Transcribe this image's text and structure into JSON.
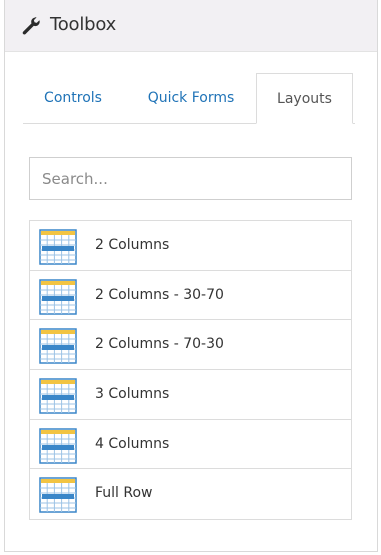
{
  "header": {
    "title": "Toolbox",
    "icon": "wrench-icon"
  },
  "tabs": [
    {
      "label": "Controls",
      "active": false
    },
    {
      "label": "Quick Forms",
      "active": false
    },
    {
      "label": "Layouts",
      "active": true
    }
  ],
  "search": {
    "placeholder": "Search...",
    "value": ""
  },
  "layouts": [
    {
      "label": "2 Columns"
    },
    {
      "label": "2 Columns - 30-70"
    },
    {
      "label": "2 Columns - 70-30"
    },
    {
      "label": "3 Columns"
    },
    {
      "label": "4 Columns"
    },
    {
      "label": "Full Row"
    }
  ],
  "colors": {
    "link": "#1f73b7",
    "header_bg": "#f2f0f3",
    "icon_blue": "#3a86c8",
    "icon_yellow": "#f2c443"
  }
}
